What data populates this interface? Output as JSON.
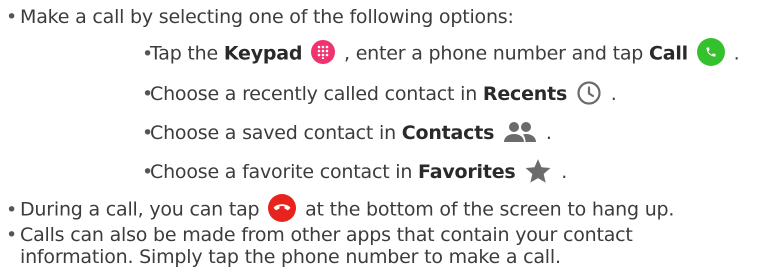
{
  "bullets": [
    {
      "text": "Make a call by selecting one of the following options:"
    },
    {
      "text": "During a call, you can tap",
      "text_after": "at the bottom of the screen to hang up."
    },
    {
      "line1": "Calls can also be made from other apps that contain your contact",
      "line2": "information. Simply tap the phone number to make a call."
    }
  ],
  "sub_items": [
    {
      "prefix": "Tap the",
      "bold": "Keypad",
      "middle": ", enter a phone number and tap",
      "bold2": "Call",
      "suffix": "."
    },
    {
      "prefix": "Choose a recently called contact in",
      "bold": "Recents",
      "suffix": "."
    },
    {
      "prefix": "Choose a saved contact in",
      "bold": "Contacts",
      "suffix": "."
    },
    {
      "prefix": "Choose a favorite contact in",
      "bold": "Favorites",
      "suffix": "."
    }
  ],
  "bullet_char": "•",
  "icons": {
    "keypad": "dialpad-icon",
    "call": "phone-icon",
    "recents": "clock-icon",
    "contacts": "people-icon",
    "favorites": "star-icon",
    "hangup": "hang-up-icon"
  },
  "colors": {
    "keypad": "#f0326e",
    "call": "#34c12d",
    "hangup": "#e8221c",
    "glyph": "#6b6b6b"
  }
}
